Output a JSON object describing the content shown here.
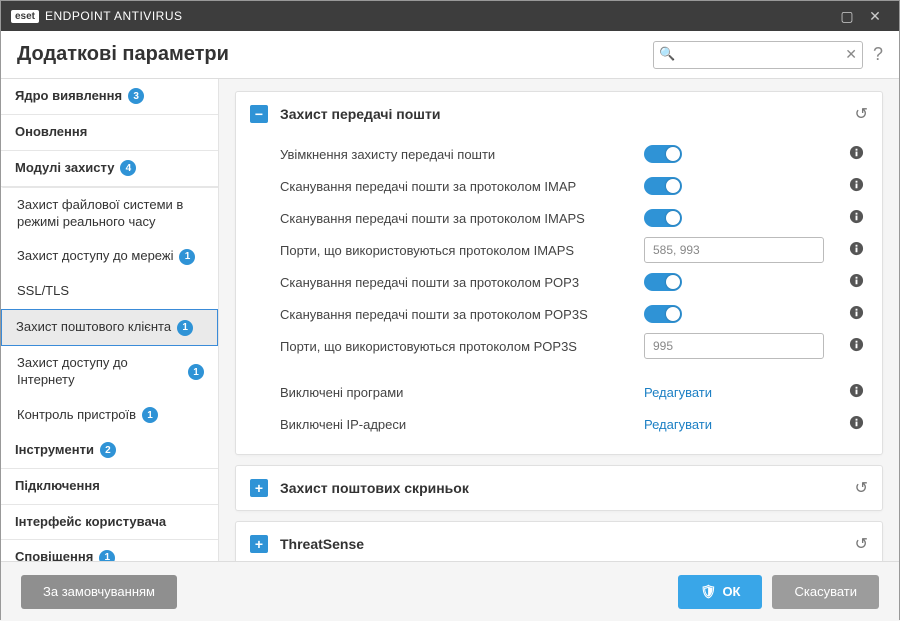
{
  "titlebar": {
    "brand": "eset",
    "product": "ENDPOINT ANTIVIRUS"
  },
  "header": {
    "title": "Додаткові параметри",
    "search_placeholder": ""
  },
  "sidebar": {
    "groups": [
      {
        "label": "Ядро виявлення",
        "badge": "3",
        "sub": []
      },
      {
        "label": "Оновлення",
        "badge": "",
        "sub": []
      },
      {
        "label": "Модулі захисту",
        "badge": "4",
        "sub": [
          {
            "label": "Захист файлової системи в режимі реального часу",
            "badge": ""
          },
          {
            "label": "Захист доступу до мережі",
            "badge": "1"
          },
          {
            "label": "SSL/TLS",
            "badge": ""
          },
          {
            "label": "Захист поштового клієнта",
            "badge": "1",
            "active": true
          },
          {
            "label": "Захист доступу до Інтернету",
            "badge": "1"
          },
          {
            "label": "Контроль пристроїв",
            "badge": "1"
          }
        ]
      },
      {
        "label": "Інструменти",
        "badge": "2",
        "sub": []
      },
      {
        "label": "Підключення",
        "badge": "",
        "sub": []
      },
      {
        "label": "Інтерфейс користувача",
        "badge": "",
        "sub": []
      },
      {
        "label": "Сповіщення",
        "badge": "1",
        "sub": []
      }
    ]
  },
  "panel_open": {
    "title": "Захист передачі пошти",
    "rows": [
      {
        "label": "Увімкнення захисту передачі пошти",
        "type": "switch"
      },
      {
        "label": "Сканування передачі пошти за протоколом IMAP",
        "type": "switch"
      },
      {
        "label": "Сканування передачі пошти за протоколом IMAPS",
        "type": "switch"
      },
      {
        "label": "Порти, що використовуються протоколом IMAPS",
        "type": "input",
        "value": "585, 993"
      },
      {
        "label": "Сканування передачі пошти за протоколом POP3",
        "type": "switch"
      },
      {
        "label": "Сканування передачі пошти за протоколом POP3S",
        "type": "switch"
      },
      {
        "label": "Порти, що використовуються протоколом POP3S",
        "type": "input",
        "value": "995"
      }
    ],
    "extras": [
      {
        "label": "Виключені програми",
        "action": "Редагувати"
      },
      {
        "label": "Виключені IP-адреси",
        "action": "Редагувати"
      }
    ]
  },
  "panels_closed": [
    {
      "title": "Захист поштових скриньок"
    },
    {
      "title": "ThreatSense"
    }
  ],
  "footer": {
    "defaults": "За замовчуванням",
    "ok": "ОК",
    "cancel": "Скасувати"
  }
}
